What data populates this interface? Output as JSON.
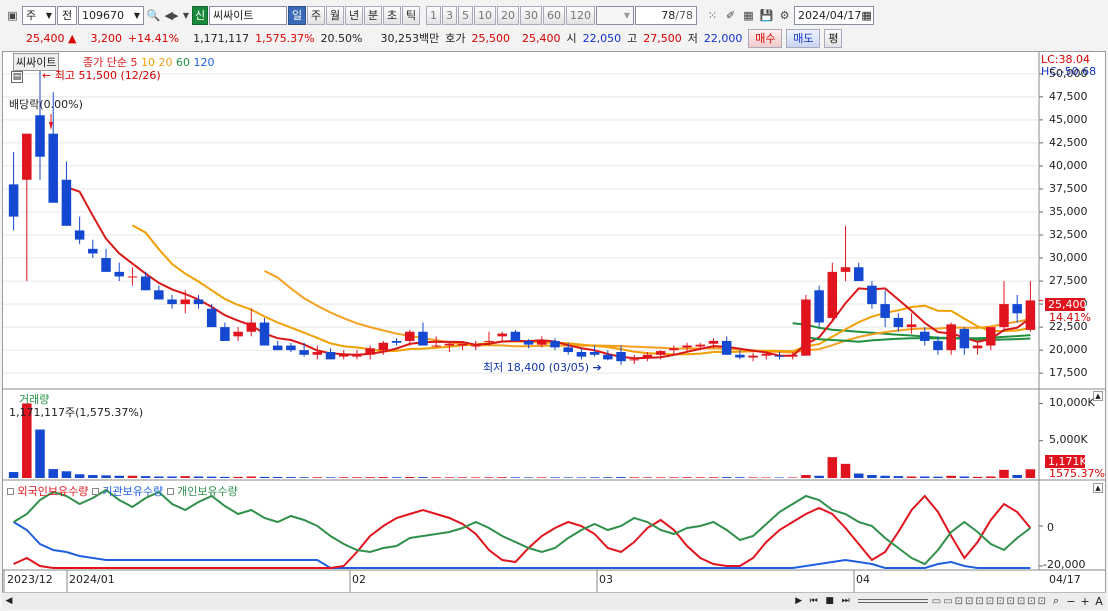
{
  "toolbar": {
    "market": "주",
    "period_sel": "전",
    "code": "109670",
    "badge": "신",
    "name": "씨싸이트",
    "periods": [
      "일",
      "주",
      "월",
      "년",
      "분",
      "초",
      "틱"
    ],
    "nums": [
      "1",
      "3",
      "5",
      "10",
      "20",
      "30",
      "60",
      "120"
    ],
    "count": "78",
    "total": "/78",
    "date": "2024/04/17"
  },
  "quote": {
    "price": "25,400",
    "arrow": "▲",
    "change": "3,200",
    "pct": "+14.41%",
    "volume": "1,171,117",
    "vol_pct": "1,575.37%",
    "turnover": "20.50%",
    "amount": "30,253백만",
    "hoga_label": "호가",
    "hoga_ask": "25,500",
    "hoga_bid": "25,400",
    "open_label": "시",
    "open": "22,050",
    "high_label": "고",
    "high": "27,500",
    "low_label": "저",
    "low": "22,000",
    "buy": "매수",
    "sell": "매도",
    "avg": "평"
  },
  "chart": {
    "name_tag": "씨싸이트",
    "ma_title": "종가 단순",
    "ma": [
      "5",
      "10",
      "20",
      "60",
      "120"
    ],
    "high_note": "최고 51,500 (12/26)",
    "low_note": "최저 18,400 (03/05)",
    "dividend": "배당락(0.00%)",
    "lc": "LC:38.04",
    "hc": "HC:-50.68",
    "price_ticks": [
      "50,000",
      "47,500",
      "45,000",
      "42,500",
      "40,000",
      "37,500",
      "35,000",
      "32,500",
      "30,000",
      "27,500",
      "25,000",
      "22,500",
      "20,000",
      "17,500"
    ],
    "cur_price": "25,400",
    "cur_pct": "14.41%",
    "vol_title": "거래량",
    "vol_note": "1,171,117주(1,575.37%)",
    "vol_ticks": [
      "10,000K",
      "5,000K"
    ],
    "cur_vol": "1,171K",
    "cur_vol_pct": "1575.37%",
    "ind_titles": [
      "외국인보유수량",
      "기관보유수량",
      "개인보유수량"
    ],
    "ind_ticks": [
      "0",
      "-20,000"
    ],
    "x_labels": [
      "2023/12",
      "2024/01",
      "02",
      "03",
      "04",
      "04/17"
    ]
  },
  "colors": {
    "up": "#e0141e",
    "down": "#1448d0",
    "ma5": "#d81818",
    "ma10": "#f0a000",
    "ma20": "#f5a020",
    "ma60": "#209040",
    "foreign": "#e0141e",
    "inst": "#2060e0",
    "indiv": "#30904a"
  },
  "chart_data": {
    "type": "candlestick",
    "candles": [
      [
        38000,
        41500,
        33000,
        34500
      ],
      [
        38500,
        43500,
        27500,
        43500
      ],
      [
        45500,
        51500,
        38500,
        41000
      ],
      [
        43500,
        48000,
        38500,
        36000
      ],
      [
        38500,
        40500,
        33500,
        33500
      ],
      [
        33000,
        34500,
        31500,
        32000
      ],
      [
        31000,
        32000,
        30000,
        30500
      ],
      [
        30000,
        31000,
        28500,
        28500
      ],
      [
        28500,
        29500,
        27500,
        28000
      ],
      [
        28000,
        29000,
        27000,
        28000
      ],
      [
        28000,
        28500,
        26500,
        26500
      ],
      [
        26500,
        27000,
        25500,
        25500
      ],
      [
        25500,
        26000,
        24500,
        25000
      ],
      [
        25000,
        26500,
        24000,
        25500
      ],
      [
        25500,
        26000,
        24500,
        25000
      ],
      [
        24500,
        25000,
        22500,
        22500
      ],
      [
        22500,
        23000,
        21000,
        21000
      ],
      [
        21500,
        22500,
        21000,
        22000
      ],
      [
        22000,
        24500,
        21500,
        23000
      ],
      [
        23000,
        23500,
        20500,
        20500
      ],
      [
        20500,
        21000,
        20000,
        20000
      ],
      [
        20500,
        20800,
        19800,
        20000
      ],
      [
        20000,
        20800,
        19300,
        19500
      ],
      [
        19500,
        20500,
        19000,
        19800
      ],
      [
        19800,
        20200,
        19000,
        19000
      ],
      [
        19300,
        20000,
        19000,
        19500
      ],
      [
        19300,
        20000,
        19000,
        19600
      ],
      [
        19500,
        20500,
        19000,
        20200
      ],
      [
        20000,
        21000,
        19500,
        20800
      ],
      [
        21000,
        21300,
        20500,
        20800
      ],
      [
        21000,
        22200,
        20500,
        22000
      ],
      [
        22000,
        23000,
        21000,
        20500
      ],
      [
        20500,
        21500,
        20300,
        20500
      ],
      [
        20500,
        21000,
        19800,
        20700
      ],
      [
        20500,
        21000,
        20000,
        20700
      ],
      [
        20500,
        21000,
        20000,
        20500
      ],
      [
        21000,
        22000,
        20500,
        21000
      ],
      [
        21500,
        22000,
        21000,
        21800
      ],
      [
        22000,
        22200,
        21000,
        21000
      ],
      [
        21000,
        21200,
        20200,
        20600
      ],
      [
        20600,
        21500,
        20300,
        21000
      ],
      [
        21000,
        21300,
        20000,
        20300
      ],
      [
        20300,
        20800,
        19500,
        19800
      ],
      [
        19800,
        20200,
        19000,
        19300
      ],
      [
        19800,
        20500,
        19300,
        19500
      ],
      [
        19500,
        20000,
        18900,
        19000
      ],
      [
        19800,
        20500,
        18400,
        18800
      ],
      [
        19000,
        19500,
        18500,
        19000
      ],
      [
        19200,
        19800,
        18800,
        19500
      ],
      [
        19500,
        20000,
        19000,
        19900
      ],
      [
        20000,
        20500,
        19500,
        20200
      ],
      [
        20300,
        20800,
        19800,
        20500
      ],
      [
        20400,
        20800,
        20000,
        20600
      ],
      [
        20700,
        21300,
        20200,
        21000
      ],
      [
        21000,
        21500,
        19500,
        19500
      ],
      [
        19500,
        20000,
        19000,
        19200
      ],
      [
        19200,
        19700,
        18800,
        19400
      ],
      [
        19400,
        19900,
        19000,
        19600
      ],
      [
        19400,
        19800,
        19000,
        19300
      ],
      [
        19300,
        19800,
        19000,
        19500
      ],
      [
        19400,
        26000,
        19400,
        25500
      ],
      [
        26500,
        27000,
        22500,
        23000
      ],
      [
        23500,
        29500,
        23000,
        28500
      ],
      [
        28500,
        33500,
        27500,
        29000
      ],
      [
        29000,
        29500,
        27500,
        27500
      ],
      [
        27000,
        27500,
        24500,
        25000
      ],
      [
        25000,
        26500,
        22500,
        23500
      ],
      [
        23500,
        24000,
        22000,
        22500
      ],
      [
        22500,
        24000,
        21800,
        22800
      ],
      [
        22000,
        22500,
        20500,
        21000
      ],
      [
        21000,
        21500,
        19500,
        20000
      ],
      [
        20000,
        23000,
        19500,
        22800
      ],
      [
        22300,
        22500,
        19500,
        20200
      ],
      [
        20200,
        21000,
        19500,
        20500
      ],
      [
        20500,
        22500,
        20000,
        22500
      ],
      [
        22500,
        27500,
        22000,
        25000
      ],
      [
        25000,
        26000,
        23000,
        24000
      ],
      [
        22200,
        27500,
        22000,
        25400
      ]
    ],
    "volume": [
      800,
      10000,
      6500,
      1200,
      900,
      500,
      400,
      350,
      300,
      300,
      250,
      200,
      200,
      250,
      200,
      180,
      150,
      150,
      200,
      150,
      140,
      120,
      100,
      100,
      90,
      100,
      100,
      110,
      120,
      100,
      130,
      120,
      100,
      90,
      90,
      80,
      90,
      100,
      90,
      80,
      80,
      80,
      80,
      80,
      90,
      100,
      120,
      90,
      80,
      80,
      90,
      100,
      90,
      100,
      120,
      100,
      80,
      70,
      70,
      70,
      400,
      300,
      2800,
      1900,
      600,
      400,
      300,
      250,
      200,
      200,
      180,
      300,
      200,
      150,
      200,
      1100,
      400,
      1171
    ],
    "price_range": [
      16000,
      51500
    ],
    "volume_range": [
      0,
      11000
    ]
  }
}
